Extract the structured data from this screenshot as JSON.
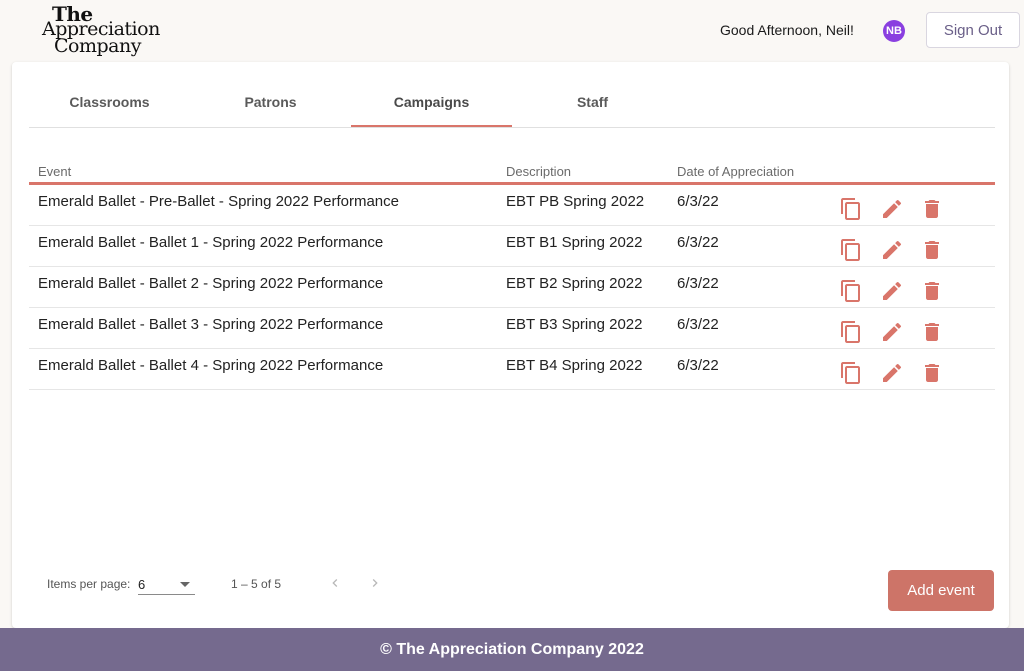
{
  "brand": {
    "line1": "The",
    "line2": "Appreciation",
    "line3": "Company"
  },
  "header": {
    "greeting": "Good Afternoon, Neil!",
    "avatar_initials": "NB",
    "avatar_color": "#8a3fe0",
    "signout_label": "Sign Out"
  },
  "tabs": [
    {
      "label": "Classrooms",
      "active": false
    },
    {
      "label": "Patrons",
      "active": false
    },
    {
      "label": "Campaigns",
      "active": true
    },
    {
      "label": "Staff",
      "active": false
    }
  ],
  "table": {
    "columns": [
      "Event",
      "Description",
      "Date of Appreciation"
    ],
    "rows": [
      {
        "event": "Emerald Ballet - Pre-Ballet - Spring 2022 Performance",
        "description": "EBT PB Spring 2022",
        "date": "6/3/22"
      },
      {
        "event": "Emerald Ballet - Ballet 1 - Spring 2022 Performance",
        "description": "EBT B1 Spring 2022",
        "date": "6/3/22"
      },
      {
        "event": "Emerald Ballet - Ballet 2 - Spring 2022 Performance",
        "description": "EBT B2 Spring 2022",
        "date": "6/3/22"
      },
      {
        "event": "Emerald Ballet - Ballet 3 - Spring 2022 Performance",
        "description": "EBT B3 Spring 2022",
        "date": "6/3/22"
      },
      {
        "event": "Emerald Ballet - Ballet 4 - Spring 2022 Performance",
        "description": "EBT B4 Spring 2022",
        "date": "6/3/22"
      }
    ],
    "row_actions": [
      "copy-icon",
      "edit-icon",
      "delete-icon"
    ]
  },
  "paginator": {
    "items_per_page_label": "Items per page:",
    "items_per_page_value": "6",
    "range_label": "1 – 5 of 5"
  },
  "add_event_label": "Add event",
  "footer": {
    "text": "© The Appreciation Company 2022"
  },
  "colors": {
    "accent": "#d9756a",
    "button": "#cd7468",
    "footer": "#756a8e",
    "signout_text": "#6a5f88"
  }
}
